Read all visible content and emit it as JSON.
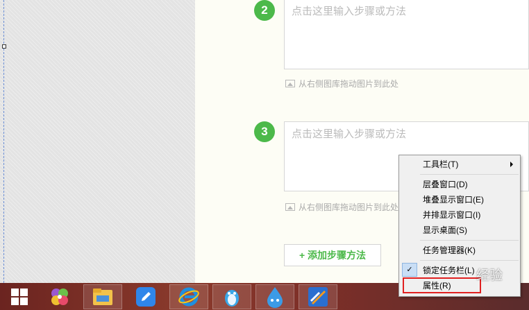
{
  "editor": {
    "steps": [
      {
        "number": "2",
        "placeholder": "点击这里输入步骤或方法",
        "image_hint": "从右侧图库拖动图片到此处"
      },
      {
        "number": "3",
        "placeholder": "点击这里输入步骤或方法",
        "image_hint": "从右侧图库拖动图片到此处"
      }
    ],
    "add_step_label": "+ 添加步骤方法"
  },
  "context_menu": {
    "items": [
      {
        "label": "工具栏(T)",
        "has_submenu": true
      },
      {
        "label": "层叠窗口(D)"
      },
      {
        "label": "堆叠显示窗口(E)"
      },
      {
        "label": "并排显示窗口(I)"
      },
      {
        "label": "显示桌面(S)"
      },
      {
        "label": "任务管理器(K)"
      },
      {
        "label": "锁定任务栏(L)",
        "checked": true
      },
      {
        "label": "属性(R)",
        "highlighted": true
      }
    ]
  },
  "watermark": "经验",
  "taskbar": {
    "icons": [
      "windows-start-icon",
      "flower-app-icon",
      "file-explorer-icon",
      "edit-pen-icon",
      "ie-browser-icon",
      "qq-penguin-icon",
      "water-drop-app-icon",
      "media-app-icon"
    ]
  },
  "colors": {
    "accent_green": "#4cb94a",
    "highlight_red": "#e02020"
  }
}
